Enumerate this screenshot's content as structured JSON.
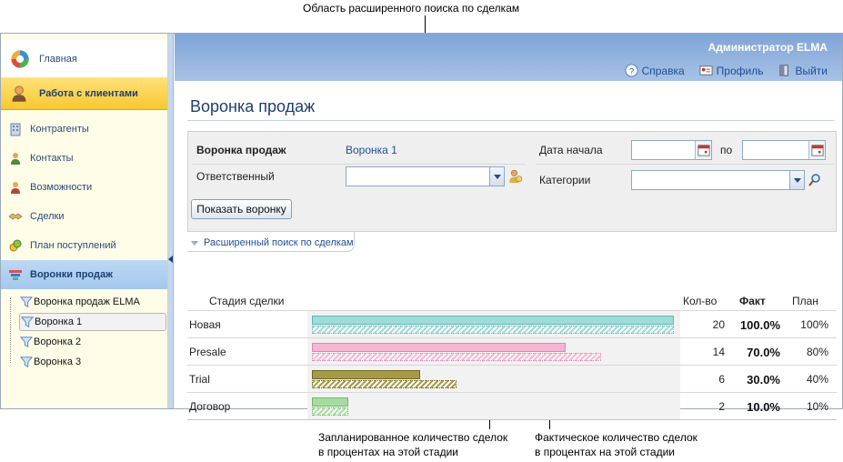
{
  "annotations": {
    "top": "Область расширенного поиска по сделкам",
    "plan": [
      "Запланированное количество сделок",
      "в процентах на этой стадии"
    ],
    "fact": [
      "Фактическое количество сделок",
      "в процентах на этой стадии"
    ]
  },
  "sidebar": {
    "home": "Главная",
    "section": "Работа с клиентами",
    "items": [
      "Контрагенты",
      "Контакты",
      "Возможности",
      "Сделки",
      "План поступлений",
      "Воронки продаж"
    ],
    "tree": [
      "Воронка продаж ELMA",
      "Воронка 1",
      "Воронка 2",
      "Воронка 3"
    ]
  },
  "header": {
    "user": "Администратор ELMA",
    "links": [
      "Справка",
      "Профиль",
      "Выйти"
    ]
  },
  "page": {
    "title": "Воронка продаж"
  },
  "filter": {
    "funnel_label": "Воронка продаж",
    "funnel_value": "Воронка 1",
    "responsible_label": "Ответственный",
    "date_label": "Дата начала",
    "date_to": "по",
    "categories_label": "Категории",
    "show_button": "Показать воронку",
    "advanced": "Расширенный поиск по сделкам"
  },
  "table": {
    "headers": {
      "stage": "Стадия сделки",
      "count": "Кол-во",
      "fact": "Факт",
      "plan": "План"
    },
    "rows": [
      {
        "stage": "Новая",
        "count": "20",
        "fact": "100.0%",
        "plan": "100%",
        "fact_pct": 100,
        "plan_pct": 100,
        "color": "#9fdbd8",
        "border": "#5fb8b5"
      },
      {
        "stage": "Presale",
        "count": "14",
        "fact": "70.0%",
        "plan": "80%",
        "fact_pct": 70,
        "plan_pct": 80,
        "color": "#f6b6d2",
        "border": "#dd86ae"
      },
      {
        "stage": "Trial",
        "count": "6",
        "fact": "30.0%",
        "plan": "40%",
        "fact_pct": 30,
        "plan_pct": 40,
        "color": "#a69a48",
        "border": "#6f6520"
      },
      {
        "stage": "Договор",
        "count": "2",
        "fact": "10.0%",
        "plan": "10%",
        "fact_pct": 10,
        "plan_pct": 10,
        "color": "#a7dba0",
        "border": "#6dbb63"
      }
    ]
  }
}
